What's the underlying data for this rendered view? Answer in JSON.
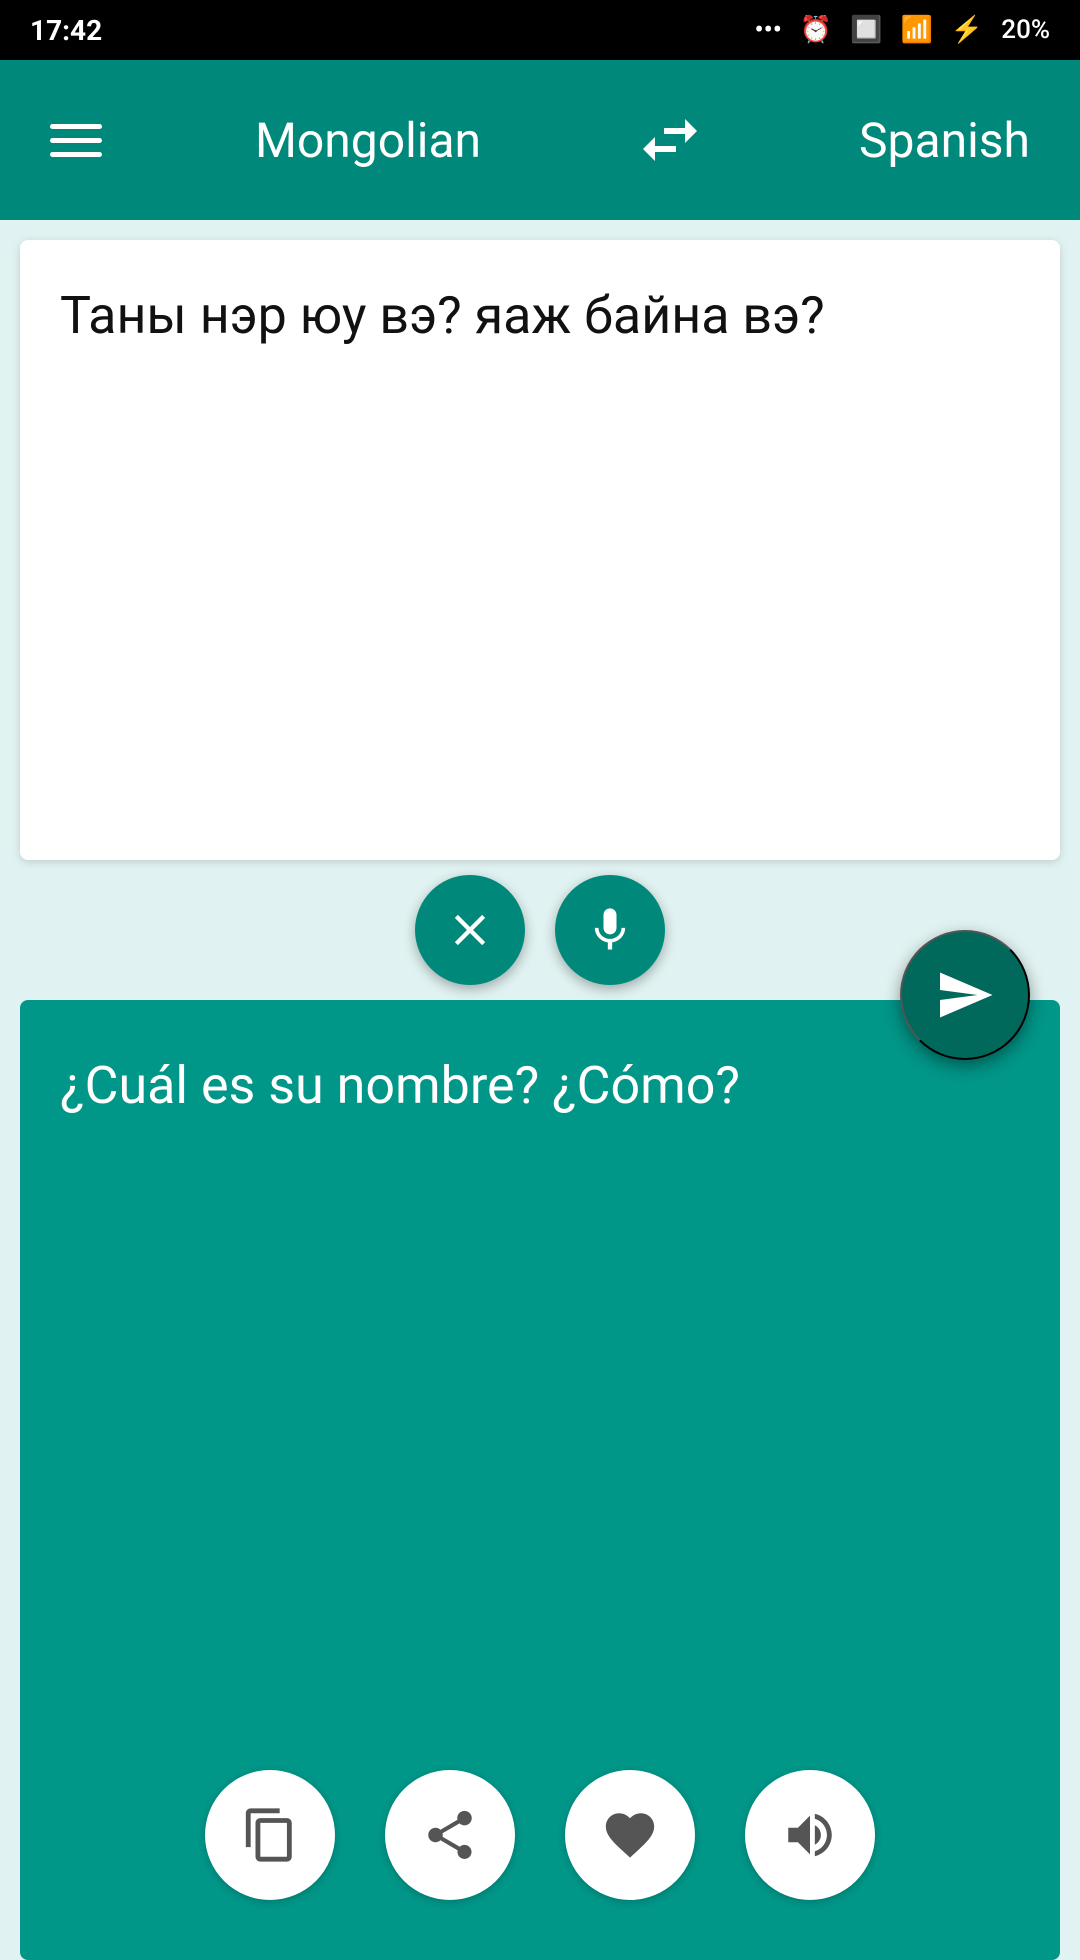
{
  "status_bar": {
    "time": "17:42",
    "dots": "•••",
    "battery": "20%"
  },
  "header": {
    "menu_label": "Menu",
    "source_language": "Mongolian",
    "swap_label": "Swap languages",
    "target_language": "Spanish"
  },
  "source": {
    "text": "Таны нэр юу вэ? яаж байна вэ?",
    "clear_label": "Clear",
    "mic_label": "Microphone"
  },
  "target": {
    "text": "¿Cuál es su nombre? ¿Cómo?",
    "copy_label": "Copy",
    "share_label": "Share",
    "favorite_label": "Favorite",
    "speaker_label": "Speaker"
  },
  "send_label": "Send / Translate"
}
